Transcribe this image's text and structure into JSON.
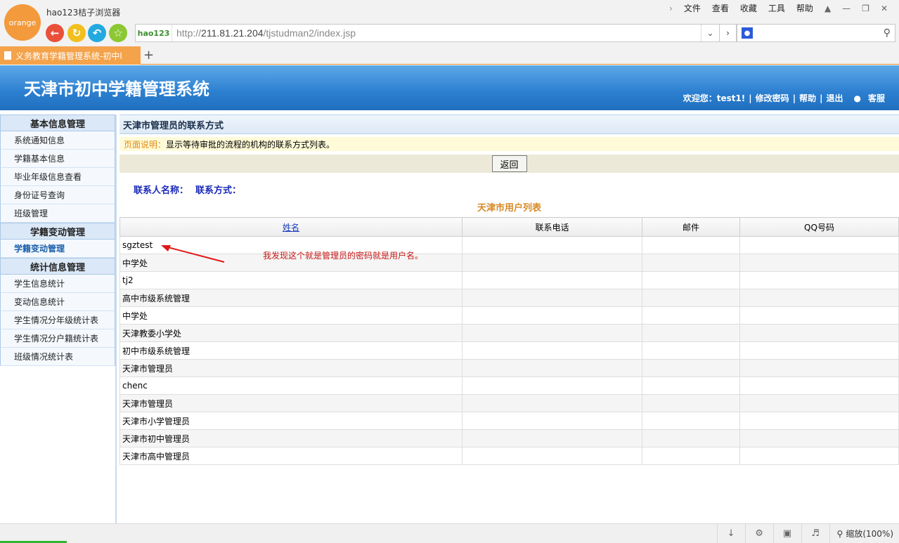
{
  "browser": {
    "logo_text": "orange",
    "brand": "hao123桔子浏览器",
    "menu": [
      "文件",
      "查看",
      "收藏",
      "工具",
      "帮助"
    ],
    "address_logo": "hao123",
    "url_prefix": "http://",
    "url_host": "211.81.21.204",
    "url_path": "/tjstudman2/index.jsp",
    "tab_title": "义务教育学籍管理系统-初中l",
    "new_tab": "+",
    "zoom_label": "缩放(100%)"
  },
  "header": {
    "title": "天津市初中学籍管理系统",
    "welcome": "欢迎您：test1!",
    "links": [
      "修改密码",
      "帮助",
      "退出",
      "客服"
    ]
  },
  "sidebar": {
    "groups": [
      {
        "title": "基本信息管理",
        "items": [
          "系统通知信息",
          "学籍基本信息",
          "毕业年级信息查看",
          "身份证号查询",
          "班级管理"
        ]
      },
      {
        "title": "学籍变动管理",
        "items": [
          "学籍变动管理"
        ]
      },
      {
        "title": "统计信息管理",
        "items": [
          "学生信息统计",
          "变动信息统计",
          "学生情况分年级统计表",
          "学生情况分户籍统计表",
          "班级情况统计表"
        ]
      }
    ]
  },
  "main": {
    "page_title": "天津市管理员的联系方式",
    "notice_label": "页面说明：",
    "notice_text": "显示等待审批的流程的机构的联系方式列表。",
    "back_button": "返回",
    "contact_name_label": "联系人名称：",
    "contact_method_label": "联系方式：",
    "list_title": "天津市用户列表",
    "columns": [
      "姓名",
      "联系电话",
      "邮件",
      "QQ号码"
    ],
    "rows": [
      "sgztest",
      "中学处",
      "tj2",
      "高中市级系统管理",
      "中学处",
      "天津教委小学处",
      "初中市级系统管理",
      "天津市管理员",
      "chenc",
      "天津市管理员",
      "天津市小学管理员",
      "天津市初中管理员",
      "天津市高中管理员"
    ],
    "annotation": "我发现这个就是管理员的密码就是用户名。"
  },
  "colors": {
    "header_blue": "#2c7fd0",
    "tab_orange": "#f4a34b",
    "annotation_red": "#c81818",
    "list_title_orange": "#d88a26"
  }
}
